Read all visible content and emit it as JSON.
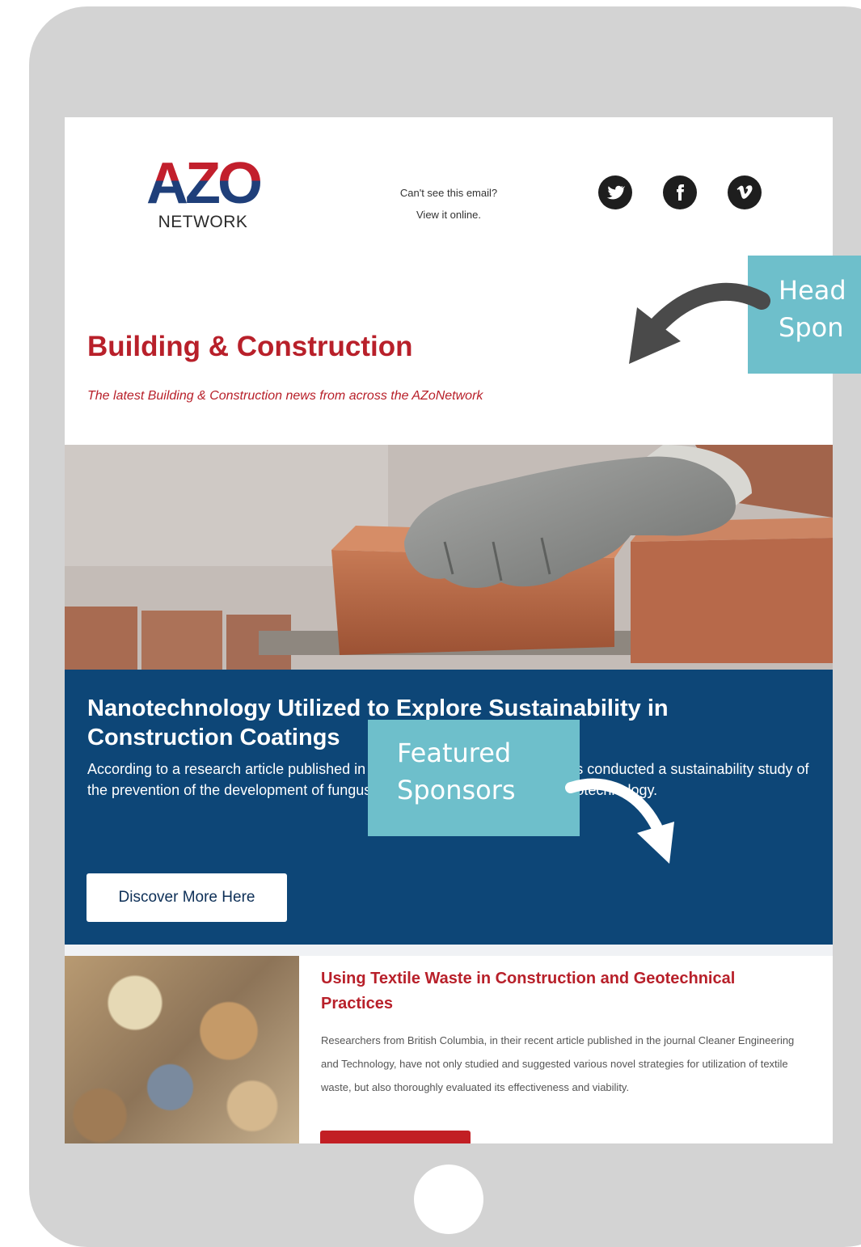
{
  "email": {
    "logo": {
      "mark": "AZO",
      "sub": "NETWORK"
    },
    "view_online": {
      "line1": "Can't see this email?",
      "line2": "View it online."
    },
    "socials": [
      {
        "icon": "twitter-icon",
        "glyph": "t"
      },
      {
        "icon": "facebook-icon",
        "glyph": "f"
      },
      {
        "icon": "vimeo-icon",
        "glyph": "v"
      }
    ],
    "section": {
      "title": "Building & Construction",
      "subtitle": "The latest Building & Construction news from across the AZoNetwork"
    },
    "featured_article": {
      "title": "Nanotechnology Utilized to Explore Sustainability in Construction Coatings",
      "body": "According to a research article published in Materials, a group of researchers conducted a sustainability study of the prevention of the development of fungus in building structures using nanotechnology.",
      "cta": "Discover More Here"
    },
    "article": {
      "title": "Using Textile Waste in Construction and Geotechnical Practices",
      "body": "Researchers from British Columbia, in their recent article published in the journal Cleaner Engineering and Technology, have not only studied and suggested various novel strategies for utilization of textile waste, but also thoroughly evaluated its effectiveness and viability."
    }
  },
  "annotations": {
    "header_sponsor": {
      "line1": "Head",
      "line2": "Spon"
    },
    "featured_sponsors": {
      "line1": "Featured",
      "line2": "Sponsors"
    }
  },
  "colors": {
    "tablet_frame": "#d3d3d3",
    "brand_red": "#b8202a",
    "brand_blue": "#0d4677",
    "callout_teal": "#6ebfcb",
    "arrow": "#4a4a4a"
  }
}
